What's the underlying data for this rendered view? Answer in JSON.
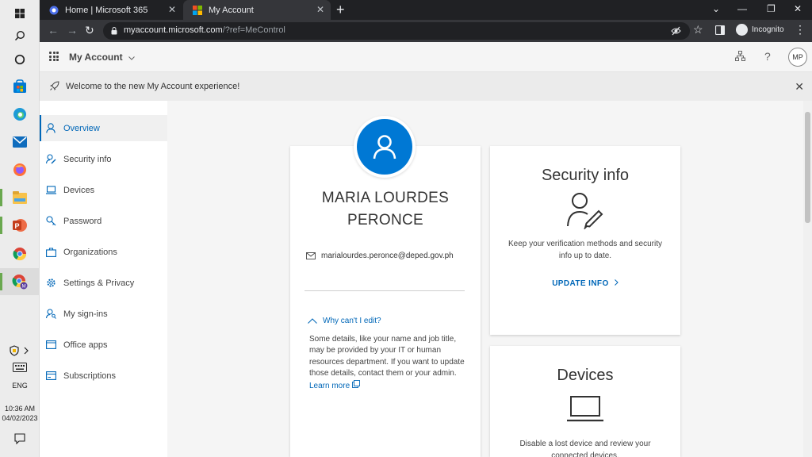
{
  "browser": {
    "tabs": [
      {
        "title": "Home | Microsoft 365",
        "active": false
      },
      {
        "title": "My Account",
        "active": true
      }
    ],
    "url_host": "myaccount.microsoft.com",
    "url_path": "/?ref=MeControl",
    "incognito_label": "Incognito"
  },
  "taskbar": {
    "language": "ENG",
    "time": "10:36 AM",
    "date": "04/02/2023"
  },
  "header": {
    "app_title": "My Account",
    "avatar_initials": "MP",
    "help_label": "?"
  },
  "banner": {
    "text": "Welcome to the new My Account experience!"
  },
  "sidebar": {
    "items": [
      {
        "label": "Overview",
        "icon": "person-icon",
        "selected": true
      },
      {
        "label": "Security info",
        "icon": "person-edit-icon"
      },
      {
        "label": "Devices",
        "icon": "laptop-icon"
      },
      {
        "label": "Password",
        "icon": "key-icon"
      },
      {
        "label": "Organizations",
        "icon": "briefcase-icon"
      },
      {
        "label": "Settings & Privacy",
        "icon": "gear-icon"
      },
      {
        "label": "My sign-ins",
        "icon": "person-key-icon"
      },
      {
        "label": "Office apps",
        "icon": "office-icon"
      },
      {
        "label": "Subscriptions",
        "icon": "card-icon"
      }
    ]
  },
  "profile": {
    "name_line1": "MARIA LOURDES",
    "name_line2": "PERONCE",
    "email": "marialourdes.peronce@deped.gov.ph",
    "why_label": "Why can't I edit?",
    "why_text": "Some details, like your name and job title, may be provided by your IT or human resources department. If you want to update those details, contact them or your admin.",
    "learn_more": "Learn more"
  },
  "security_card": {
    "title": "Security info",
    "description": "Keep your verification methods and security info up to date.",
    "link": "UPDATE INFO"
  },
  "devices_card": {
    "title": "Devices",
    "description": "Disable a lost device and review your connected devices."
  },
  "colors": {
    "accent": "#0067b8",
    "avatar_blue": "#0078d4",
    "tabbar": "#202124",
    "toolbar": "#35363a"
  }
}
